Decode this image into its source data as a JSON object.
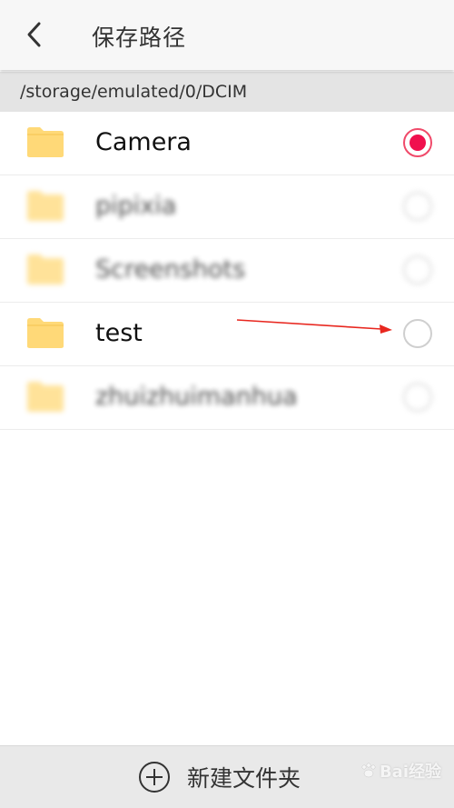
{
  "header": {
    "title": "保存路径",
    "back_icon": "chevron-left-icon"
  },
  "path": "/storage/emulated/0/DCIM",
  "folders": [
    {
      "label": "Camera",
      "selected": true,
      "blurred": false
    },
    {
      "label": "pipixia",
      "selected": false,
      "blurred": true
    },
    {
      "label": "Screenshots",
      "selected": false,
      "blurred": true
    },
    {
      "label": "test",
      "selected": false,
      "blurred": false
    },
    {
      "label": "zhuizhuimanhua",
      "selected": false,
      "blurred": true
    }
  ],
  "footer": {
    "new_folder_label": "新建文件夹",
    "new_folder_icon": "plus-circle-icon"
  },
  "watermark": {
    "text": "Bai经验"
  },
  "colors": {
    "accent": "#f0104e",
    "folder": "#ffd978",
    "annotation_arrow": "#e8271f"
  }
}
